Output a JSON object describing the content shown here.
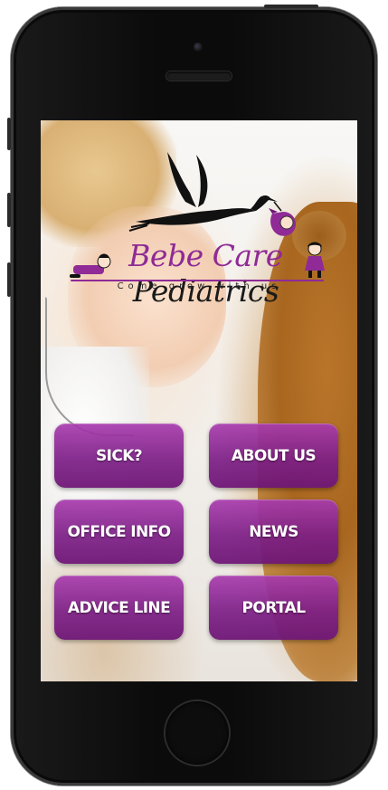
{
  "app": {
    "logo": {
      "title_part1": "Bebe Care",
      "title_part2": "Pediatrics",
      "tagline": "Come grow with us",
      "icons": [
        "stork-icon",
        "baby-bundle-icon",
        "girl-figure-icon",
        "boy-figure-icon"
      ]
    },
    "menu": {
      "sick_label": "SICK?",
      "about_label": "ABOUT US",
      "office_label": "OFFICE INFO",
      "news_label": "NEWS",
      "advice_label": "ADVICE LINE",
      "portal_label": "PORTAL"
    }
  },
  "colors": {
    "brand_purple": "#8f2a96",
    "button_top": "#a83bae",
    "button_bottom": "#6e1676",
    "text_dark": "#1a1a1a"
  }
}
